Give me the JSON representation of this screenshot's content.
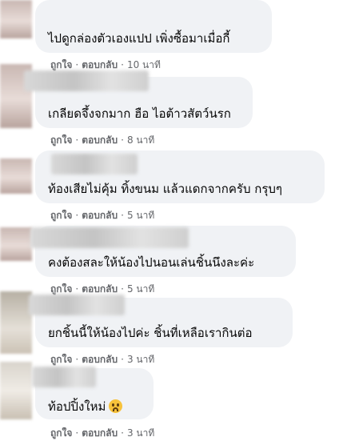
{
  "comments": [
    {
      "text": "ไปดูกล่องตัวเองแปป เพิ่งซื้อมาเมื่อกี้",
      "like": "ถูกใจ",
      "reply": "ตอบกลับ",
      "time": "10 นาที"
    },
    {
      "text": "เกลียดจึ้งจกมาก ฮือ ไอต้าวสัตว์นรก",
      "like": "ถูกใจ",
      "reply": "ตอบกลับ",
      "time": "8 นาที"
    },
    {
      "text": "ท้องเสียไม่คุ้ม ทิ้งขนม แล้วแดกจากครับ กรุบๆ",
      "like": "ถูกใจ",
      "reply": "ตอบกลับ",
      "time": "5 นาที"
    },
    {
      "text": "คงต้องสละให้น้องไปนอนเล่นชิ้นนึงละค่ะ",
      "like": "ถูกใจ",
      "reply": "ตอบกลับ",
      "time": "5 นาที"
    },
    {
      "text": "ยกชิ้นนี้ให้น้องไปค่ะ ชิ้นที่เหลือเรากินต่อ",
      "like": "ถูกใจ",
      "reply": "ตอบกลับ",
      "time": "3 นาที"
    },
    {
      "text": "ท้อปปิ้งใหม่",
      "emoji": "worried-face",
      "like": "ถูกใจ",
      "reply": "ตอบกลับ",
      "time": "3 นาที"
    }
  ],
  "separator": "·"
}
